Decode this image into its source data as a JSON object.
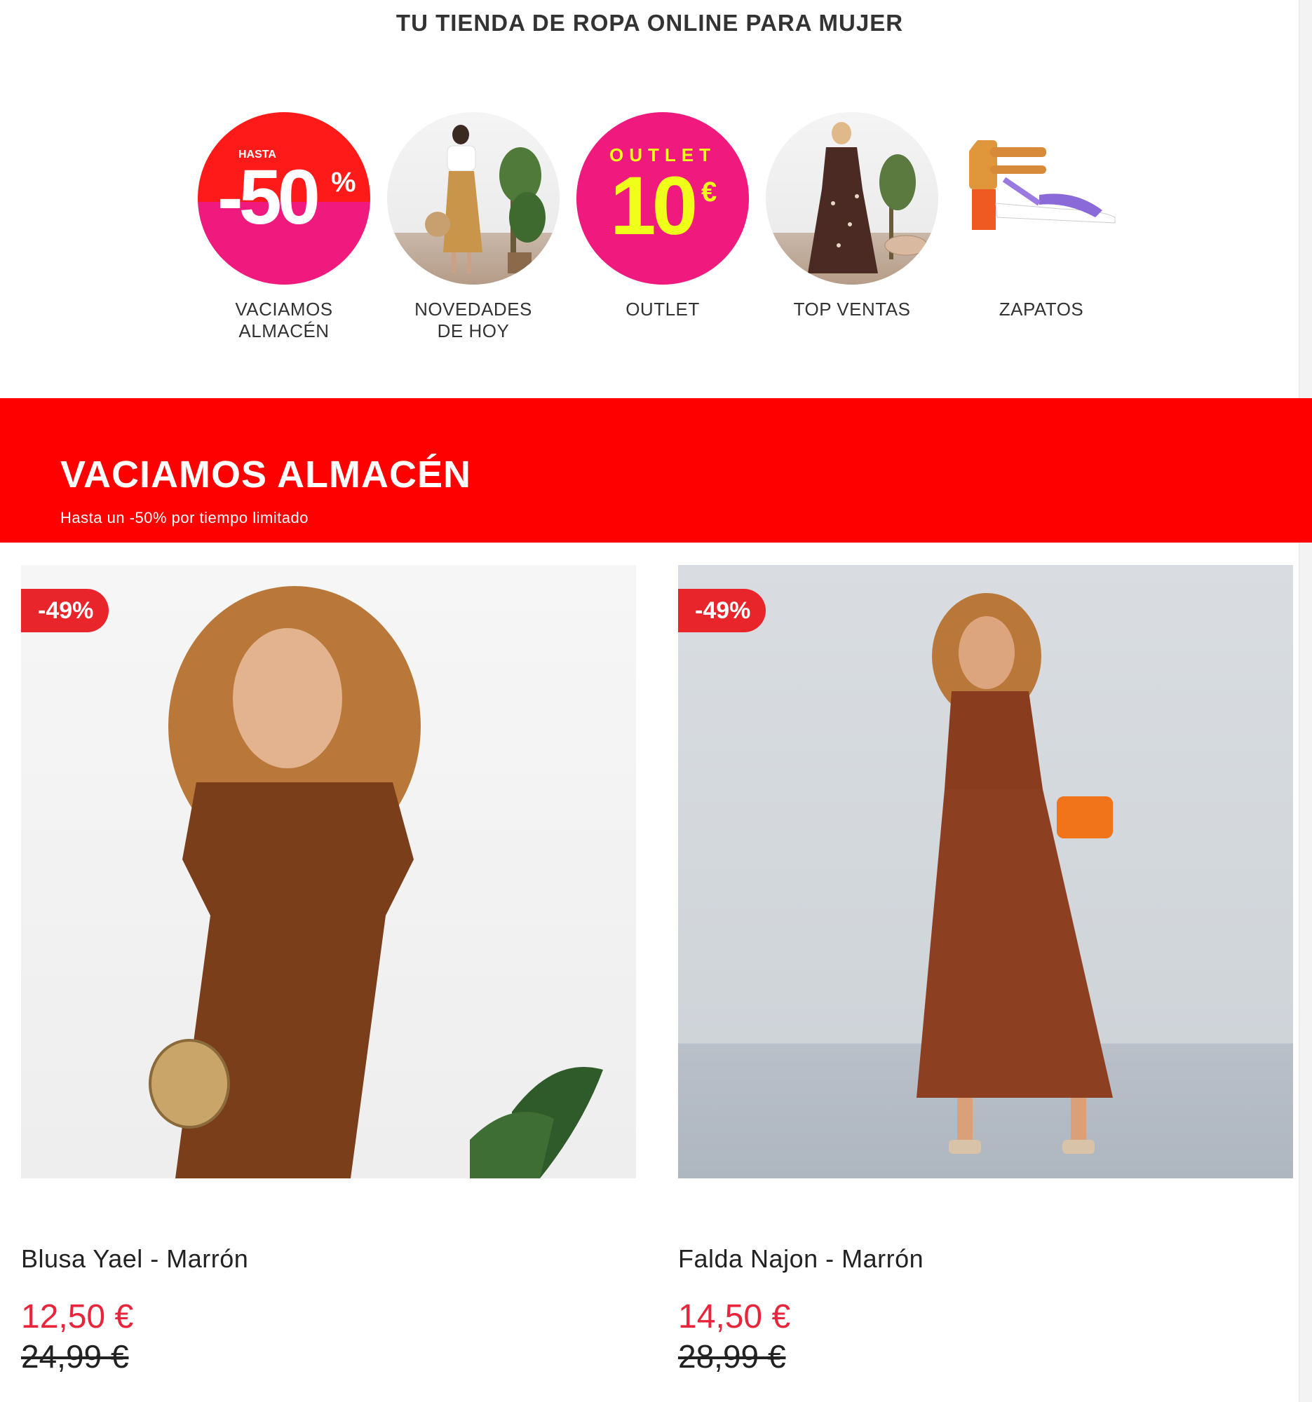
{
  "header": {
    "tagline": "TU TIENDA DE ROPA ONLINE PARA MUJER"
  },
  "categories": [
    {
      "label": "VACIAMOS ALMACÉN",
      "badge_top": "HASTA",
      "badge_big": "-50",
      "badge_symbol": "%"
    },
    {
      "label": "NOVEDADES DE HOY"
    },
    {
      "label": "OUTLET",
      "badge_top": "OUTLET",
      "badge_big": "10",
      "badge_symbol": "€"
    },
    {
      "label": "TOP VENTAS"
    },
    {
      "label": "ZAPATOS"
    }
  ],
  "banner": {
    "title": "VACIAMOS ALMACÉN",
    "subtitle": "Hasta un -50% por tiempo limitado",
    "color": "#ff0000"
  },
  "products": [
    {
      "discount": "-49%",
      "name": "Blusa Yael - Marrón",
      "price": "12,50 €",
      "old_price": "24,99 €"
    },
    {
      "discount": "-49%",
      "name": "Falda Najon - Marrón",
      "price": "14,50 €",
      "old_price": "28,99 €"
    }
  ],
  "colors": {
    "accent": "#e8253b",
    "pink": "#f0197d",
    "yellow": "#f0ff1a"
  }
}
